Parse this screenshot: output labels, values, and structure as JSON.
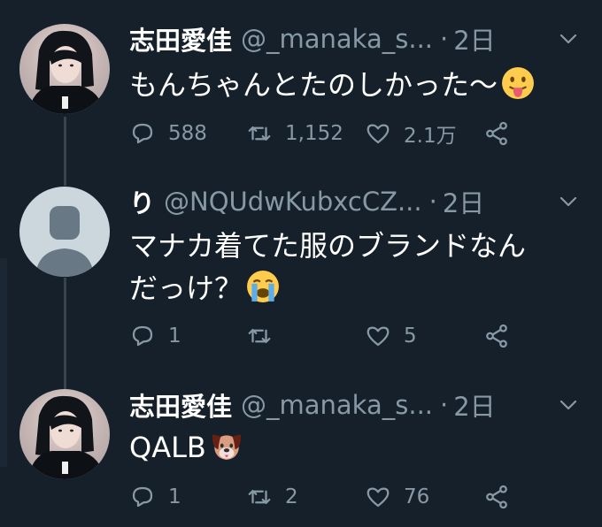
{
  "tweets": [
    {
      "display_name": "志田愛佳",
      "handle": "@_manaka_s...",
      "dot": "·",
      "time": "2日",
      "avatar": "user-photo",
      "text": "もんちゃんとたのしかった〜",
      "emoji": "tongue-face-emoji",
      "actions": {
        "reply_count": "588",
        "retweet_count": "1,152",
        "like_count": "2.1万"
      }
    },
    {
      "display_name": "り",
      "handle": "@NQUdwKubxcCZ...",
      "dot": "·",
      "time": "2日",
      "avatar": "default-profile",
      "text_line1": "マナカ着てた服のブランドなん",
      "text_line2": "だっけ？",
      "emoji": "loudly-crying-face-emoji",
      "actions": {
        "reply_count": "1",
        "retweet_count": "",
        "like_count": "5"
      }
    },
    {
      "display_name": "志田愛佳",
      "handle": "@_manaka_s...",
      "dot": "·",
      "time": "2日",
      "avatar": "user-photo",
      "text": "QALB",
      "emoji": "dog-face-emoji",
      "actions": {
        "reply_count": "1",
        "retweet_count": "2",
        "like_count": "76"
      }
    }
  ],
  "colors": {
    "background": "#15202b",
    "primary_text": "#ffffff",
    "secondary_text": "#8899a6",
    "thread_line": "#38444d"
  }
}
